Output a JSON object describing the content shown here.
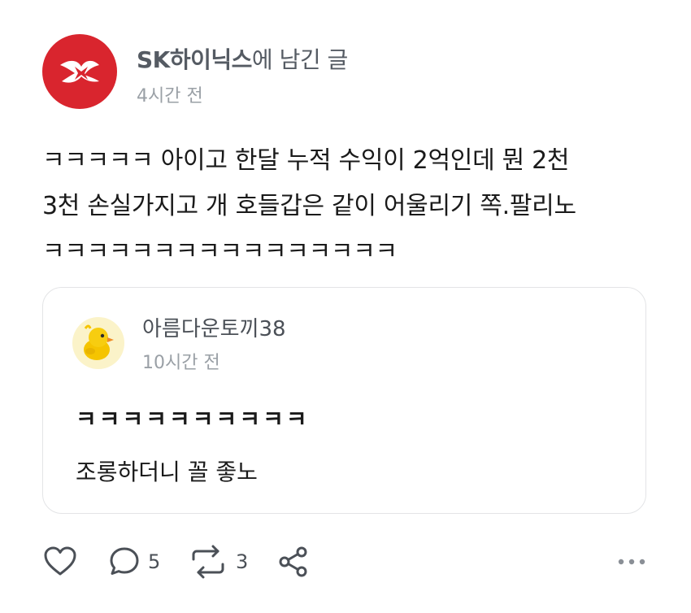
{
  "post": {
    "author": "SK하이닉스",
    "author_suffix": "에 남긴 글",
    "time": "4시간 전",
    "lines": [
      "ㅋㅋㅋㅋㅋ 아이고 한달 누적 수익이 2억인데 뭔 2천",
      "3천 손실가지고 개 호들갑은 같이 어울리기 쪽.팔리노",
      "ㅋㅋㅋㅋㅋㅋㅋㅋㅋㅋㅋㅋㅋㅋㅋㅋ"
    ]
  },
  "quoted": {
    "author": "아름다운토끼38",
    "time": "10시간 전",
    "line1": "ㅋㅋㅋㅋㅋㅋㅋㅋㅋㅋ",
    "line2": "조롱하더니 꼴 좋노"
  },
  "actions": {
    "comments": "5",
    "reposts": "3"
  },
  "colors": {
    "brand_red": "#d9252e",
    "chick_yellow": "#f5c400"
  }
}
